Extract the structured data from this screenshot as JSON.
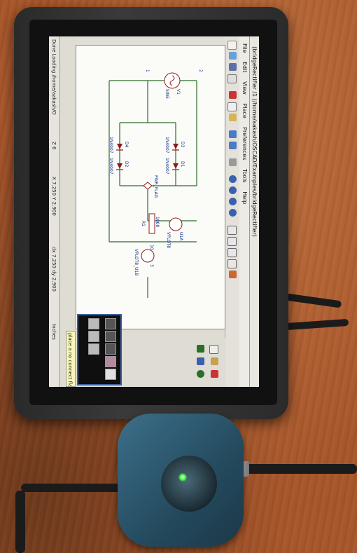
{
  "window": {
    "title": "(bridgeRectifier /1 (/home/aakash/OSCAD/Examples/bridgeRectifier)"
  },
  "menu": [
    "File",
    "Edit",
    "View",
    "Place",
    "Preferences",
    "Tools",
    "Help"
  ],
  "status": {
    "message": "Done Loading /home/aakash/O",
    "zoom": "Z 6",
    "xy": "X 7.250  Y 2.900",
    "dxdy": "dx 7.250  dy 2.900",
    "units": "Inches"
  },
  "hint": "place a no connect flag",
  "schematic": {
    "labels": {
      "v1": "V1",
      "v1_value": "SINE",
      "d1": "D1",
      "d1_part": "1N4007",
      "d2": "D2",
      "d2_part": "1N4007",
      "d3": "D3",
      "d3_part": "1N4007",
      "d4": "D4",
      "d4_part": "1N4007",
      "r1": "R1",
      "r1_value": "1000",
      "u1": "U1A",
      "u1_part": "VPLOT8",
      "u2": "VPLOT8_U1B",
      "pin1": "1",
      "pin2": "2",
      "pin10": "10",
      "pin3": "3",
      "pwr": "PWR_FLAG"
    }
  },
  "colors": {
    "wire": "#2b6e2b",
    "component": "#8b1a1a",
    "label": "#0a2a8a",
    "accent": "#3a5fa0"
  }
}
